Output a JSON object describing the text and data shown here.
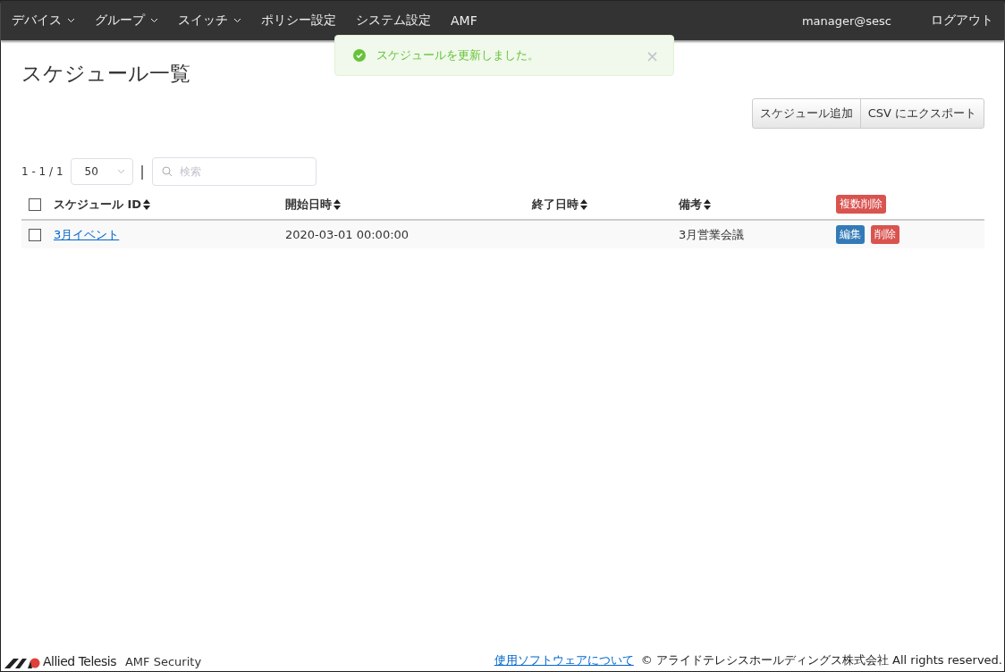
{
  "nav": {
    "items": [
      {
        "label": "デバイス",
        "dropdown": true
      },
      {
        "label": "グループ",
        "dropdown": true
      },
      {
        "label": "スイッチ",
        "dropdown": true
      },
      {
        "label": "ポリシー設定",
        "dropdown": false
      },
      {
        "label": "システム設定",
        "dropdown": false
      },
      {
        "label": "AMF",
        "dropdown": false
      }
    ],
    "user": "manager@sesc",
    "logout": "ログアウト"
  },
  "toast": {
    "message": "スケジュールを更新しました。",
    "close": "×"
  },
  "page": {
    "title": "スケジュール一覧",
    "actions": [
      "スケジュール追加",
      "CSV にエクスポート"
    ]
  },
  "pager": {
    "range": "1 - 1 / 1",
    "page_size": "50",
    "separator": "|",
    "search": {
      "placeholder": "検索"
    }
  },
  "table": {
    "select_all": {
      "checked": false
    },
    "columns": [
      {
        "label": "スケジュール ID"
      },
      {
        "label": "開始日時"
      },
      {
        "label": "終了日時"
      },
      {
        "label": "備考"
      }
    ],
    "bulk_delete": "複数削除",
    "rows": [
      {
        "checked": false,
        "id": "3月イベント",
        "start": "2020-03-01 00:00:00",
        "note": "3月営業会議",
        "edit": "編集",
        "delete": "削除"
      }
    ]
  },
  "footer": {
    "logo": "Allied Telesis",
    "product": "AMF Security",
    "link": "使用ソフトウェアについて",
    "copyright": "© アライドテレシスホールディングス株式会社 All rights reserved."
  }
}
